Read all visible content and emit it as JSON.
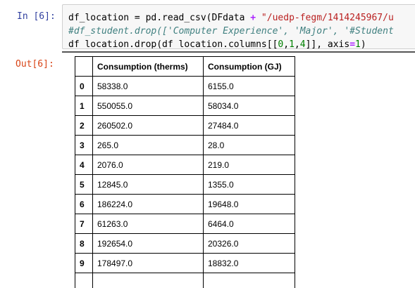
{
  "input": {
    "prompt": "In [6]:",
    "lines": [
      [
        {
          "t": "df_location = pd.read_csv(DFdata ",
          "c": ""
        },
        {
          "t": "+",
          "c": "op"
        },
        {
          "t": " \"/uedp-fegm/1414245967/u",
          "c": "str"
        }
      ],
      [
        {
          "t": "#df_student.drop(['Computer Experience', 'Major', '#Student",
          "c": "comment"
        }
      ],
      [
        {
          "t": "df_location.drop(df_location.columns[[",
          "c": ""
        },
        {
          "t": "0",
          "c": "num"
        },
        {
          "t": ",",
          "c": ""
        },
        {
          "t": "1",
          "c": "num"
        },
        {
          "t": ",",
          "c": ""
        },
        {
          "t": "4",
          "c": "num"
        },
        {
          "t": "]], axis",
          "c": ""
        },
        {
          "t": "=",
          "c": "op"
        },
        {
          "t": "1",
          "c": "num"
        },
        {
          "t": ")",
          "c": ""
        }
      ]
    ]
  },
  "output": {
    "prompt": "Out[6]:",
    "table": {
      "columns": [
        "",
        "Consumption (therms)",
        "Consumption (GJ)"
      ],
      "rows": [
        {
          "index": "0",
          "therms": "58338.0",
          "gj": "6155.0"
        },
        {
          "index": "1",
          "therms": "550055.0",
          "gj": "58034.0"
        },
        {
          "index": "2",
          "therms": "260502.0",
          "gj": "27484.0"
        },
        {
          "index": "3",
          "therms": "265.0",
          "gj": "28.0"
        },
        {
          "index": "4",
          "therms": "2076.0",
          "gj": "219.0"
        },
        {
          "index": "5",
          "therms": "12845.0",
          "gj": "1355.0"
        },
        {
          "index": "6",
          "therms": "186224.0",
          "gj": "19648.0"
        },
        {
          "index": "7",
          "therms": "61263.0",
          "gj": "6464.0"
        },
        {
          "index": "8",
          "therms": "192654.0",
          "gj": "20326.0"
        },
        {
          "index": "9",
          "therms": "178497.0",
          "gj": "18832.0"
        },
        {
          "index": "",
          "therms": "",
          "gj": ""
        }
      ]
    }
  }
}
